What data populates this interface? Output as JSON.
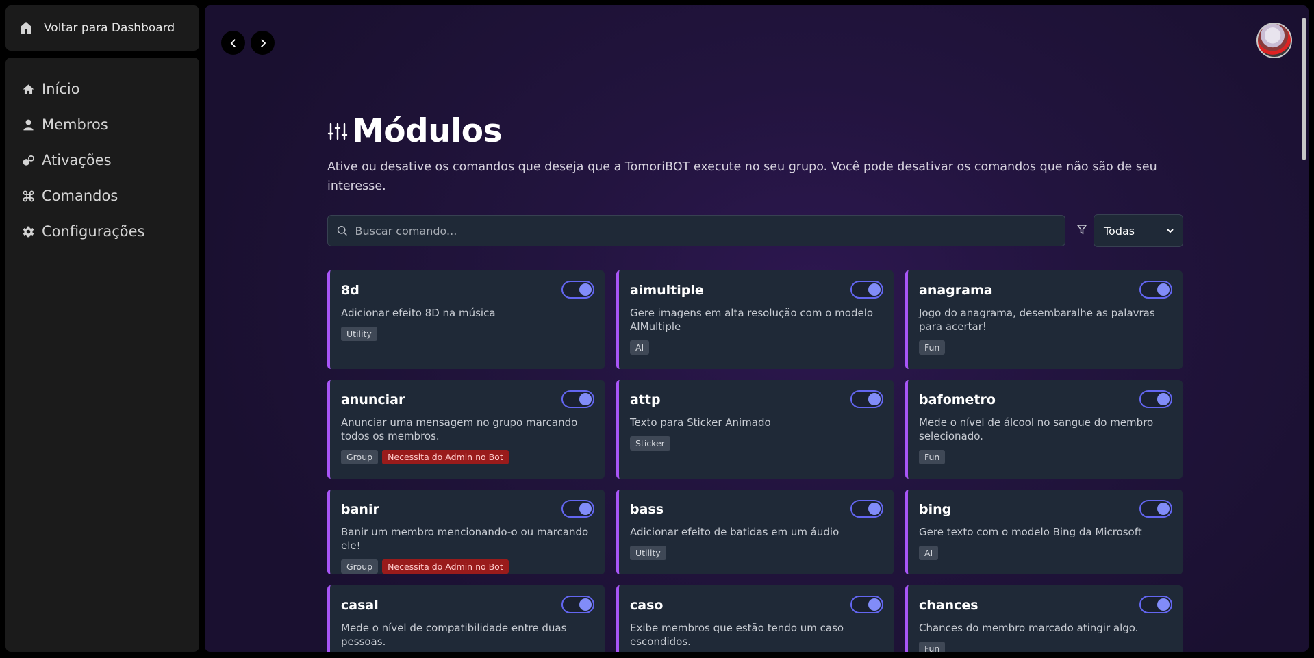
{
  "sidebar": {
    "back_label": "Voltar para Dashboard",
    "items": [
      {
        "label": "Início",
        "icon": "home-icon"
      },
      {
        "label": "Membros",
        "icon": "user-icon"
      },
      {
        "label": "Ativações",
        "icon": "toggle-icon"
      },
      {
        "label": "Comandos",
        "icon": "command-icon"
      },
      {
        "label": "Configurações",
        "icon": "gear-icon"
      }
    ]
  },
  "page": {
    "title": "Módulos",
    "subtitle": "Ative ou desative os comandos que deseja que a TomoriBOT execute no seu grupo. Você pode desativar os comandos que não são de seu interesse."
  },
  "search": {
    "placeholder": "Buscar comando..."
  },
  "filter": {
    "selected": "Todas"
  },
  "commands": [
    {
      "name": "8d",
      "desc": "Adicionar efeito 8D na música",
      "tags": [
        "Utility"
      ],
      "enabled": true
    },
    {
      "name": "aimultiple",
      "desc": "Gere imagens em alta resolução com o modelo AIMultiple",
      "tags": [
        "AI"
      ],
      "enabled": true
    },
    {
      "name": "anagrama",
      "desc": "Jogo do anagrama, desembaralhe as palavras para acertar!",
      "tags": [
        "Fun"
      ],
      "enabled": true
    },
    {
      "name": "anunciar",
      "desc": "Anunciar uma mensagem no grupo marcando todos os membros.",
      "tags": [
        "Group",
        "Necessita do Admin no Bot"
      ],
      "enabled": true
    },
    {
      "name": "attp",
      "desc": "Texto para Sticker Animado",
      "tags": [
        "Sticker"
      ],
      "enabled": true
    },
    {
      "name": "bafometro",
      "desc": "Mede o nível de álcool no sangue do membro selecionado.",
      "tags": [
        "Fun"
      ],
      "enabled": true
    },
    {
      "name": "banir",
      "desc": "Banir um membro mencionando-o ou marcando ele!",
      "tags": [
        "Group",
        "Necessita do Admin no Bot"
      ],
      "enabled": true
    },
    {
      "name": "bass",
      "desc": "Adicionar efeito de batidas em um áudio",
      "tags": [
        "Utility"
      ],
      "enabled": true
    },
    {
      "name": "bing",
      "desc": "Gere texto com o modelo Bing da Microsoft",
      "tags": [
        "AI"
      ],
      "enabled": true
    },
    {
      "name": "casal",
      "desc": "Mede o nível de compatibilidade entre duas pessoas.",
      "tags": [],
      "enabled": true
    },
    {
      "name": "caso",
      "desc": "Exibe membros que estão tendo um caso escondidos.",
      "tags": [],
      "enabled": true
    },
    {
      "name": "chances",
      "desc": "Chances do membro marcado atingir algo.",
      "tags": [
        "Fun"
      ],
      "enabled": true
    }
  ]
}
